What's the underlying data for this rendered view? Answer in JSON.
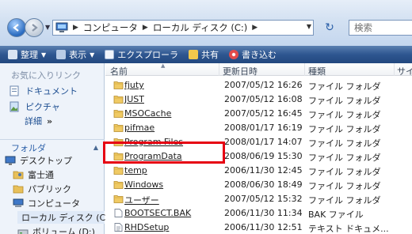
{
  "address_bar": {
    "breadcrumbs": [
      "コンピュータ",
      "ローカル ディスク (C:)"
    ],
    "search_placeholder": "検索"
  },
  "toolbar": {
    "items": [
      "整理",
      "表示",
      "エクスプローラ",
      "共有",
      "書き込む"
    ]
  },
  "nav_pane": {
    "favorites_header": "お気に入りリンク",
    "favorites": [
      "ドキュメント",
      "ピクチャ"
    ],
    "more_label": "詳細",
    "more_glyph": "»",
    "folders_header": "フォルダ",
    "tree": [
      {
        "label": "デスクトップ",
        "icon": "desktop-icon"
      },
      {
        "label": "富士通",
        "icon": "user-folder-icon"
      },
      {
        "label": "パブリック",
        "icon": "folder-icon"
      },
      {
        "label": "コンピュータ",
        "icon": "computer-icon"
      },
      {
        "label": "ローカル ディスク (C",
        "icon": "drive-icon"
      },
      {
        "label": "ボリューム (D:)",
        "icon": "drive-icon"
      }
    ]
  },
  "file_list": {
    "columns": [
      "名前",
      "更新日時",
      "種類",
      "サイズ"
    ],
    "rows": [
      {
        "name": "fjuty",
        "date": "2007/05/12 16:26",
        "type": "ファイル フォルダ",
        "icon": "folder-icon"
      },
      {
        "name": "JUST",
        "date": "2007/05/12 16:08",
        "type": "ファイル フォルダ",
        "icon": "folder-icon"
      },
      {
        "name": "MSOCache",
        "date": "2007/05/12 16:45",
        "type": "ファイル フォルダ",
        "icon": "folder-icon"
      },
      {
        "name": "pifmae",
        "date": "2008/01/17 16:19",
        "type": "ファイル フォルダ",
        "icon": "folder-icon"
      },
      {
        "name": "Program Files",
        "date": "2008/01/17 14:07",
        "type": "ファイル フォルダ",
        "icon": "folder-icon"
      },
      {
        "name": "ProgramData",
        "date": "2008/06/19 15:30",
        "type": "ファイル フォルダ",
        "icon": "folder-icon"
      },
      {
        "name": "temp",
        "date": "2006/11/30 12:45",
        "type": "ファイル フォルダ",
        "icon": "folder-icon"
      },
      {
        "name": "Windows",
        "date": "2008/06/30 18:49",
        "type": "ファイル フォルダ",
        "icon": "folder-icon"
      },
      {
        "name": "ユーザー",
        "date": "2007/05/12 15:32",
        "type": "ファイル フォルダ",
        "icon": "folder-icon"
      },
      {
        "name": "BOOTSECT.BAK",
        "date": "2006/11/30 11:34",
        "type": "BAK ファイル",
        "icon": "file-icon"
      },
      {
        "name": "RHDSetup",
        "date": "2006/11/30 12:51",
        "type": "テキスト ドキュメ...",
        "icon": "text-file-icon"
      }
    ],
    "highlighted_row": "ProgramData",
    "highlight_color": "#e60012"
  }
}
